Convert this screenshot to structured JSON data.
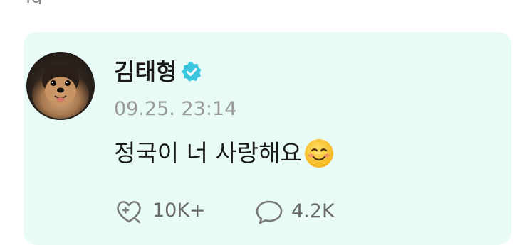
{
  "header_fragment": "ig",
  "post": {
    "author": "김태형",
    "verified_icon": "verified-badge-icon",
    "timestamp": "09.25. 23:14",
    "message": "정국이 너 사랑해요",
    "emoji": "smiling-face-icon"
  },
  "stats": {
    "reactions_icon": "heart-outline-icon",
    "reactions": "10K+",
    "comments_icon": "speech-bubble-icon",
    "comments": "4.2K"
  },
  "colors": {
    "card_background": "#e9fbf7",
    "verified": "#3cc6dd",
    "text": "#1a1a1a",
    "muted": "#9a9a9a"
  }
}
